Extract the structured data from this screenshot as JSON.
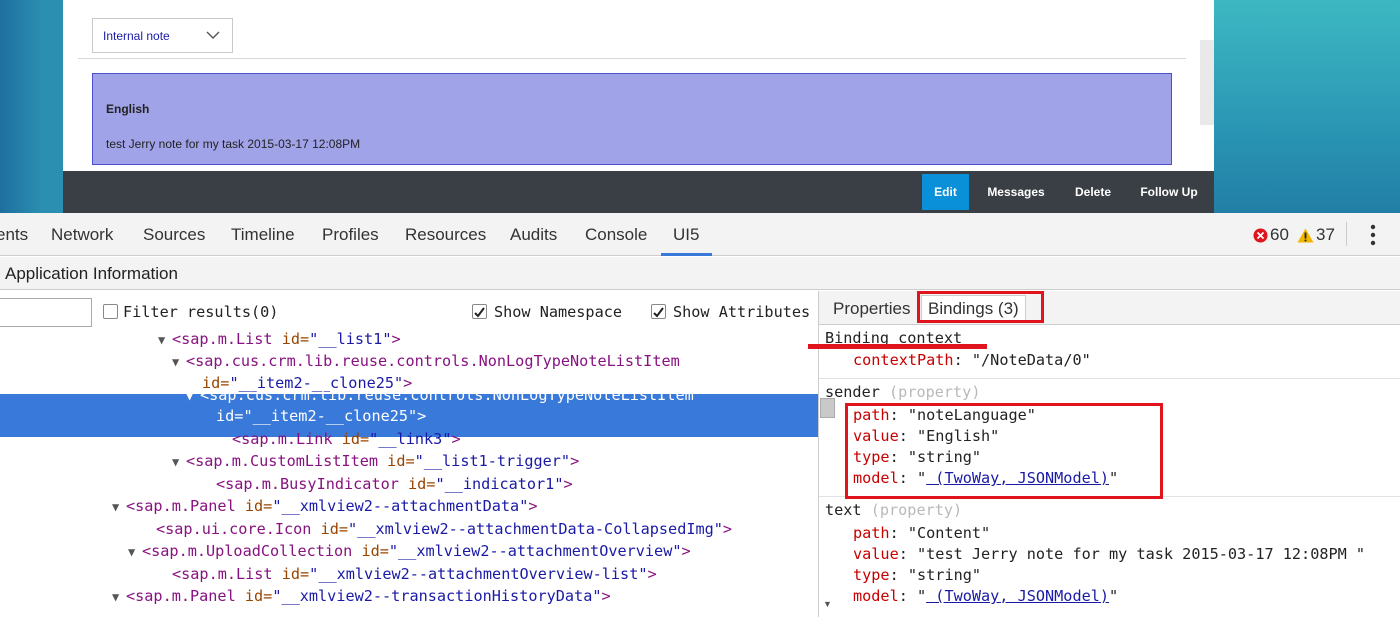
{
  "app": {
    "note_type_select": "Internal note",
    "note": {
      "language": "English",
      "text": "test Jerry note for my task 2015-03-17 12:08PM"
    },
    "footer_buttons": {
      "edit": "Edit",
      "messages": "Messages",
      "delete": "Delete",
      "follow_up": "Follow Up"
    }
  },
  "devtools": {
    "tabs": [
      "ents",
      "Network",
      "Sources",
      "Timeline",
      "Profiles",
      "Resources",
      "Audits",
      "Console",
      "UI5"
    ],
    "active_tab": "UI5",
    "error_count": "60",
    "warning_count": "37",
    "colors": {
      "accent": "#3879d9",
      "error": "#e0141c",
      "warning": "#f2b600"
    }
  },
  "ui5": {
    "section_title": "Application Information",
    "filter": {
      "input_value": "",
      "filter_label": "Filter results(0)",
      "show_namespace_label": "Show Namespace",
      "show_attributes_label": "Show Attributes"
    },
    "tree": [
      {
        "indent": 158,
        "tri": "▼",
        "tag": "<sap.m.List",
        "attr": " id=",
        "val": "\"__list1\"",
        "close": ">"
      },
      {
        "indent": 172,
        "tri": "▼",
        "tag": "<sap.cus.crm.lib.reuse.controls.NonLogTypeNoteListItem",
        "attr": "",
        "val": "",
        "close": ""
      },
      {
        "indent": 188,
        "tri": "",
        "tag": "",
        "attr": "id=",
        "val": "\"__item2-__clone25\"",
        "close": ">"
      },
      {
        "indent": 186,
        "tri": "▼",
        "tag": "<sap.cus.crm.lib.reuse.controls.NonLogTypeNoteListItem",
        "attr": "",
        "val": "",
        "close": "",
        "selected": true
      },
      {
        "indent": 202,
        "tri": "",
        "tag": "",
        "attr": "id=",
        "val": "\"__item2-__clone25\"",
        "close": ">",
        "selected": true
      },
      {
        "indent": 218,
        "tri": "",
        "tag": "<sap.m.Link",
        "attr": " id=",
        "val": "\"__link3\"",
        "close": ">"
      },
      {
        "indent": 172,
        "tri": "▼",
        "tag": "<sap.m.CustomListItem",
        "attr": " id=",
        "val": "\"__list1-trigger\"",
        "close": ">"
      },
      {
        "indent": 202,
        "tri": "",
        "tag": "<sap.m.BusyIndicator",
        "attr": " id=",
        "val": "\"__indicator1\"",
        "close": ">"
      },
      {
        "indent": 112,
        "tri": "▼",
        "tag": "<sap.m.Panel",
        "attr": " id=",
        "val": "\"__xmlview2--attachmentData\"",
        "close": ">"
      },
      {
        "indent": 142,
        "tri": "",
        "tag": "<sap.ui.core.Icon",
        "attr": " id=",
        "val": "\"__xmlview2--attachmentData-CollapsedImg\"",
        "close": ">"
      },
      {
        "indent": 128,
        "tri": "▼",
        "tag": "<sap.m.UploadCollection",
        "attr": " id=",
        "val": "\"__xmlview2--attachmentOverview\"",
        "close": ">"
      },
      {
        "indent": 158,
        "tri": "",
        "tag": "<sap.m.List",
        "attr": " id=",
        "val": "\"__xmlview2--attachmentOverview-list\"",
        "close": ">"
      },
      {
        "indent": 112,
        "tri": "▼",
        "tag": "<sap.m.Panel",
        "attr": " id=",
        "val": "\"__xmlview2--transactionHistoryData\"",
        "close": ">"
      }
    ],
    "right_tabs": {
      "properties": "Properties",
      "bindings": "Bindings (3)"
    },
    "bindings": {
      "context_title": "Binding context",
      "context_path_key": "contextPath",
      "context_path_value": "\"/NoteData/0\"",
      "sender": {
        "name": "sender",
        "kind": "(property)",
        "path_value": "\"noteLanguage\"",
        "value_value": "\"English\"",
        "type_value": "\"string\"",
        "model_link": " (TwoWay, JSONModel)"
      },
      "text": {
        "name": "text",
        "kind": "(property)",
        "path_value": "\"Content\"",
        "value_value": "\"test Jerry note for my task 2015-03-17 12:08PM \"",
        "type_value": "\"string\"",
        "model_link": " (TwoWay, JSONModel)"
      },
      "keys": {
        "path": "path",
        "value": "value",
        "type": "type",
        "model": "model"
      }
    }
  }
}
